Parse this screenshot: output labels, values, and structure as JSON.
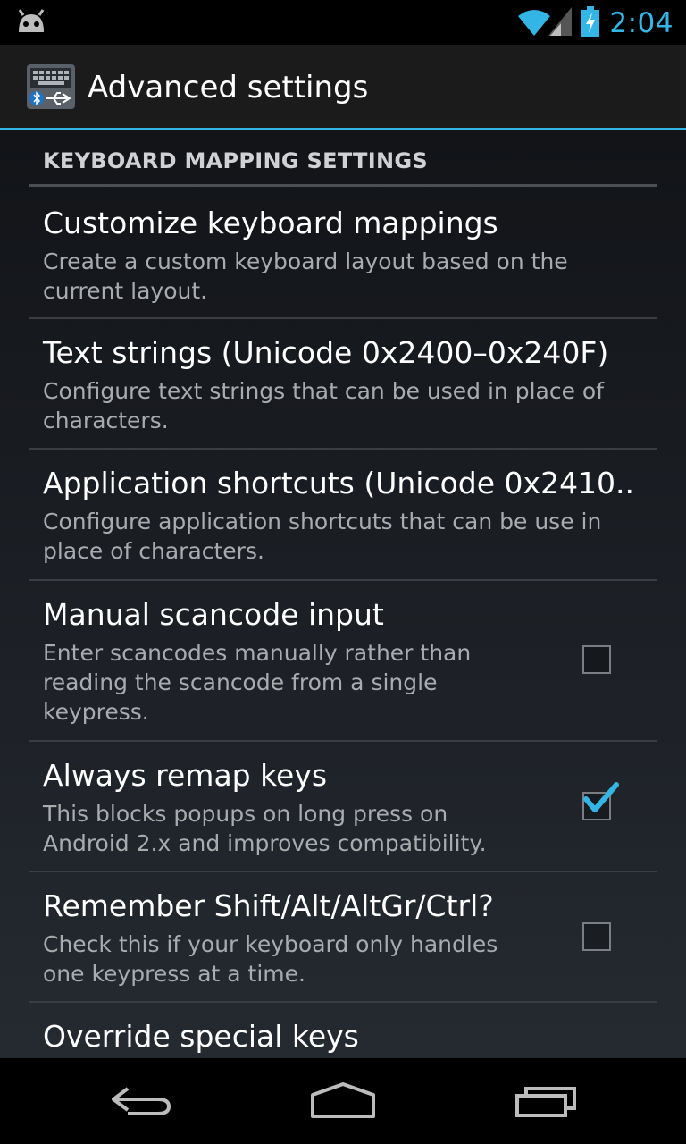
{
  "status_bar": {
    "time": "2:04",
    "accent_color": "#33b5e5",
    "icons": [
      "android-debug-icon",
      "wifi-icon",
      "signal-icon",
      "battery-charging-icon"
    ]
  },
  "action_bar": {
    "title": "Advanced settings",
    "app_icon": "keyboard-bluetooth-usb-icon"
  },
  "category": {
    "title": "KEYBOARD MAPPING SETTINGS"
  },
  "preferences": [
    {
      "title": "Customize keyboard mappings",
      "summary": "Create a custom keyboard layout based on the current layout."
    },
    {
      "title": "Text strings (Unicode 0x2400–0x240F)",
      "summary": "Configure text strings that can be used in place of characters."
    },
    {
      "title": "Application shortcuts (Unicode 0x2410..",
      "summary": "Configure application shortcuts that can be use in place of characters."
    },
    {
      "title": "Manual scancode input",
      "summary": "Enter scancodes manually rather than reading the scancode from a single keypress.",
      "checked": false
    },
    {
      "title": "Always remap keys",
      "summary": "This blocks popups on long press on Android 2.x and improves compatibility.",
      "checked": true
    },
    {
      "title": "Remember Shift/Alt/AltGr/Ctrl?",
      "summary": "Check this if your keyboard only handles one keypress at a time.",
      "checked": false
    },
    {
      "title": "Override special keys"
    }
  ],
  "nav_bar": {
    "icons": [
      "back-icon",
      "home-icon",
      "recent-apps-icon"
    ]
  }
}
